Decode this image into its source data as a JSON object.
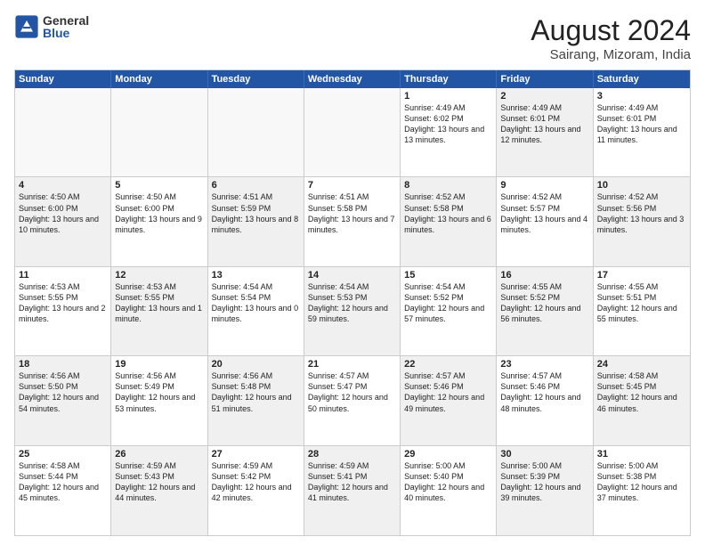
{
  "logo": {
    "general": "General",
    "blue": "Blue"
  },
  "title": {
    "month_year": "August 2024",
    "location": "Sairang, Mizoram, India"
  },
  "weekdays": [
    "Sunday",
    "Monday",
    "Tuesday",
    "Wednesday",
    "Thursday",
    "Friday",
    "Saturday"
  ],
  "weeks": [
    [
      {
        "day": "",
        "empty": true
      },
      {
        "day": "",
        "empty": true
      },
      {
        "day": "",
        "empty": true
      },
      {
        "day": "",
        "empty": true
      },
      {
        "day": "1",
        "sunrise": "4:49 AM",
        "sunset": "6:02 PM",
        "daylight": "13 hours and 13 minutes."
      },
      {
        "day": "2",
        "sunrise": "4:49 AM",
        "sunset": "6:01 PM",
        "daylight": "13 hours and 12 minutes."
      },
      {
        "day": "3",
        "sunrise": "4:49 AM",
        "sunset": "6:01 PM",
        "daylight": "13 hours and 11 minutes."
      }
    ],
    [
      {
        "day": "4",
        "sunrise": "4:50 AM",
        "sunset": "6:00 PM",
        "daylight": "13 hours and 10 minutes."
      },
      {
        "day": "5",
        "sunrise": "4:50 AM",
        "sunset": "6:00 PM",
        "daylight": "13 hours and 9 minutes."
      },
      {
        "day": "6",
        "sunrise": "4:51 AM",
        "sunset": "5:59 PM",
        "daylight": "13 hours and 8 minutes."
      },
      {
        "day": "7",
        "sunrise": "4:51 AM",
        "sunset": "5:58 PM",
        "daylight": "13 hours and 7 minutes."
      },
      {
        "day": "8",
        "sunrise": "4:52 AM",
        "sunset": "5:58 PM",
        "daylight": "13 hours and 6 minutes."
      },
      {
        "day": "9",
        "sunrise": "4:52 AM",
        "sunset": "5:57 PM",
        "daylight": "13 hours and 4 minutes."
      },
      {
        "day": "10",
        "sunrise": "4:52 AM",
        "sunset": "5:56 PM",
        "daylight": "13 hours and 3 minutes."
      }
    ],
    [
      {
        "day": "11",
        "sunrise": "4:53 AM",
        "sunset": "5:55 PM",
        "daylight": "13 hours and 2 minutes."
      },
      {
        "day": "12",
        "sunrise": "4:53 AM",
        "sunset": "5:55 PM",
        "daylight": "13 hours and 1 minute."
      },
      {
        "day": "13",
        "sunrise": "4:54 AM",
        "sunset": "5:54 PM",
        "daylight": "13 hours and 0 minutes."
      },
      {
        "day": "14",
        "sunrise": "4:54 AM",
        "sunset": "5:53 PM",
        "daylight": "12 hours and 59 minutes."
      },
      {
        "day": "15",
        "sunrise": "4:54 AM",
        "sunset": "5:52 PM",
        "daylight": "12 hours and 57 minutes."
      },
      {
        "day": "16",
        "sunrise": "4:55 AM",
        "sunset": "5:52 PM",
        "daylight": "12 hours and 56 minutes."
      },
      {
        "day": "17",
        "sunrise": "4:55 AM",
        "sunset": "5:51 PM",
        "daylight": "12 hours and 55 minutes."
      }
    ],
    [
      {
        "day": "18",
        "sunrise": "4:56 AM",
        "sunset": "5:50 PM",
        "daylight": "12 hours and 54 minutes."
      },
      {
        "day": "19",
        "sunrise": "4:56 AM",
        "sunset": "5:49 PM",
        "daylight": "12 hours and 53 minutes."
      },
      {
        "day": "20",
        "sunrise": "4:56 AM",
        "sunset": "5:48 PM",
        "daylight": "12 hours and 51 minutes."
      },
      {
        "day": "21",
        "sunrise": "4:57 AM",
        "sunset": "5:47 PM",
        "daylight": "12 hours and 50 minutes."
      },
      {
        "day": "22",
        "sunrise": "4:57 AM",
        "sunset": "5:46 PM",
        "daylight": "12 hours and 49 minutes."
      },
      {
        "day": "23",
        "sunrise": "4:57 AM",
        "sunset": "5:46 PM",
        "daylight": "12 hours and 48 minutes."
      },
      {
        "day": "24",
        "sunrise": "4:58 AM",
        "sunset": "5:45 PM",
        "daylight": "12 hours and 46 minutes."
      }
    ],
    [
      {
        "day": "25",
        "sunrise": "4:58 AM",
        "sunset": "5:44 PM",
        "daylight": "12 hours and 45 minutes."
      },
      {
        "day": "26",
        "sunrise": "4:59 AM",
        "sunset": "5:43 PM",
        "daylight": "12 hours and 44 minutes."
      },
      {
        "day": "27",
        "sunrise": "4:59 AM",
        "sunset": "5:42 PM",
        "daylight": "12 hours and 42 minutes."
      },
      {
        "day": "28",
        "sunrise": "4:59 AM",
        "sunset": "5:41 PM",
        "daylight": "12 hours and 41 minutes."
      },
      {
        "day": "29",
        "sunrise": "5:00 AM",
        "sunset": "5:40 PM",
        "daylight": "12 hours and 40 minutes."
      },
      {
        "day": "30",
        "sunrise": "5:00 AM",
        "sunset": "5:39 PM",
        "daylight": "12 hours and 39 minutes."
      },
      {
        "day": "31",
        "sunrise": "5:00 AM",
        "sunset": "5:38 PM",
        "daylight": "12 hours and 37 minutes."
      }
    ]
  ]
}
